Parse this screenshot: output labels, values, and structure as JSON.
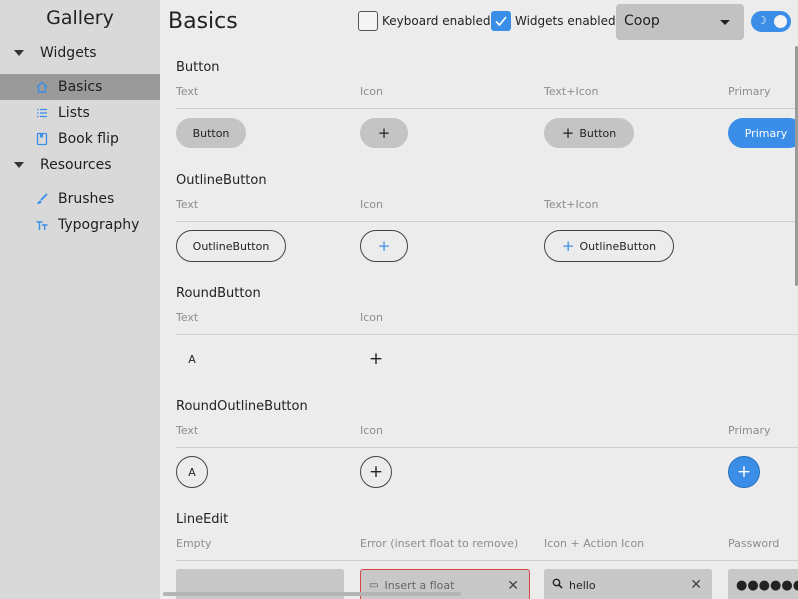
{
  "sidebar": {
    "title": "Gallery",
    "groups": [
      {
        "label": "Widgets",
        "items": [
          {
            "label": "Basics",
            "icon": "home-icon",
            "selected": true
          },
          {
            "label": "Lists",
            "icon": "list-icon"
          },
          {
            "label": "Book flip",
            "icon": "book-icon"
          }
        ]
      },
      {
        "label": "Resources",
        "items": [
          {
            "label": "Brushes",
            "icon": "brush-icon"
          },
          {
            "label": "Typography",
            "icon": "typography-icon"
          }
        ]
      }
    ]
  },
  "header": {
    "title": "Basics",
    "keyboard_label": "Keyboard enabled",
    "keyboard_checked": false,
    "widgets_label": "Widgets enabled",
    "widgets_checked": true,
    "theme_value": "Coop",
    "dark_mode_toggle": true
  },
  "sections": {
    "button": {
      "title": "Button",
      "columns": [
        "Text",
        "Icon",
        "Text+Icon",
        "Primary"
      ],
      "text_label": "Button",
      "texticon_label": "Button",
      "primary_label": "Primary"
    },
    "outline_button": {
      "title": "OutlineButton",
      "columns": [
        "Text",
        "Icon",
        "Text+Icon"
      ],
      "text_label": "OutlineButton",
      "texticon_label": "OutlineButton"
    },
    "round_button": {
      "title": "RoundButton",
      "columns": [
        "Text",
        "Icon"
      ],
      "text_label": "A"
    },
    "round_outline_button": {
      "title": "RoundOutlineButton",
      "columns": [
        "Text",
        "Icon",
        "Primary"
      ],
      "text_label": "A"
    },
    "line_edit": {
      "title": "LineEdit",
      "columns": [
        "Empty",
        "Error (insert float to remove)",
        "Icon + Action Icon",
        "Password"
      ],
      "error_placeholder": "Insert a float",
      "icon_value": "hello",
      "password_value": "●●●●●●●"
    }
  },
  "colors": {
    "accent": "#3b8ee8",
    "sidebar_bg": "#d9d9d9",
    "content_bg": "#ececec",
    "error": "#d64545"
  }
}
